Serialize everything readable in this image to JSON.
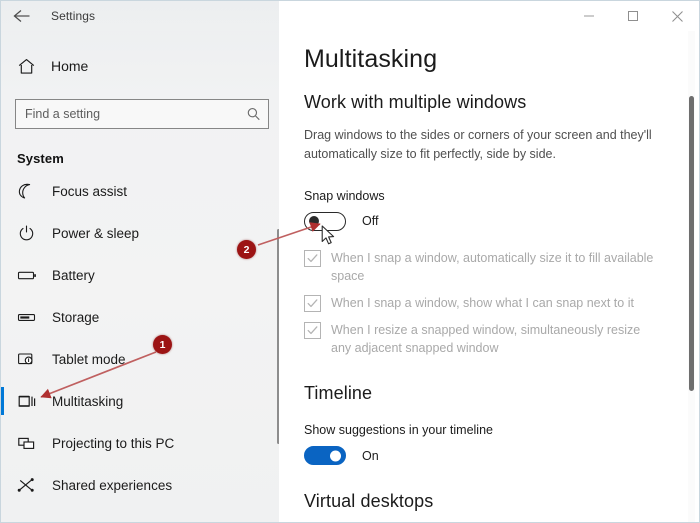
{
  "window": {
    "app_title": "Settings",
    "back_icon": "back-arrow-icon",
    "caption": {
      "minimize_icon": "minimize-icon",
      "maximize_icon": "maximize-icon",
      "close_icon": "close-icon"
    }
  },
  "sidebar": {
    "home": {
      "label": "Home",
      "icon": "home-icon"
    },
    "search": {
      "placeholder": "Find a setting",
      "value": "",
      "icon": "search-icon"
    },
    "group_label": "System",
    "items": [
      {
        "label": "Focus assist",
        "icon": "moon-icon",
        "selected": false
      },
      {
        "label": "Power & sleep",
        "icon": "power-icon",
        "selected": false
      },
      {
        "label": "Battery",
        "icon": "battery-icon",
        "selected": false
      },
      {
        "label": "Storage",
        "icon": "storage-icon",
        "selected": false
      },
      {
        "label": "Tablet mode",
        "icon": "tablet-mode-icon",
        "selected": false
      },
      {
        "label": "Multitasking",
        "icon": "multitasking-icon",
        "selected": true
      },
      {
        "label": "Projecting to this PC",
        "icon": "projecting-icon",
        "selected": false
      },
      {
        "label": "Shared experiences",
        "icon": "shared-experiences-icon",
        "selected": false
      }
    ]
  },
  "main": {
    "page_title": "Multitasking",
    "section_work": {
      "heading": "Work with multiple windows",
      "description": "Drag windows to the sides or corners of your screen and they'll automatically size to fit perfectly, side by side.",
      "snap_label": "Snap windows",
      "snap_toggle_state": "Off",
      "snap_toggle_on": false,
      "options": [
        "When I snap a window, automatically size it to fill available space",
        "When I snap a window, show what I can snap next to it",
        "When I resize a snapped window, simultaneously resize any adjacent snapped window"
      ]
    },
    "section_timeline": {
      "heading": "Timeline",
      "suggestions_label": "Show suggestions in your timeline",
      "suggestions_toggle_state": "On",
      "suggestions_toggle_on": true
    },
    "section_virtual": {
      "heading": "Virtual desktops"
    }
  },
  "annotations": {
    "markers": [
      {
        "label": "1"
      },
      {
        "label": "2"
      }
    ],
    "color": "#9c1414"
  }
}
